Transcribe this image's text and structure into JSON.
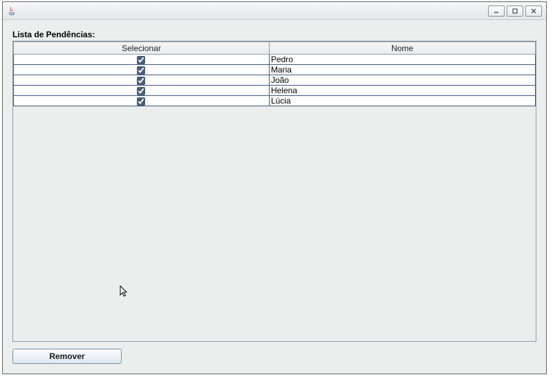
{
  "window": {
    "title": ""
  },
  "content": {
    "list_label": "Lista de Pendências:"
  },
  "table": {
    "columns": [
      "Selecionar",
      "Nome"
    ],
    "rows": [
      {
        "selected": true,
        "name": "Pedro"
      },
      {
        "selected": true,
        "name": "Maria"
      },
      {
        "selected": true,
        "name": "João"
      },
      {
        "selected": true,
        "name": "Helena"
      },
      {
        "selected": true,
        "name": "Lúcia"
      }
    ]
  },
  "buttons": {
    "remove_label": "Remover"
  }
}
